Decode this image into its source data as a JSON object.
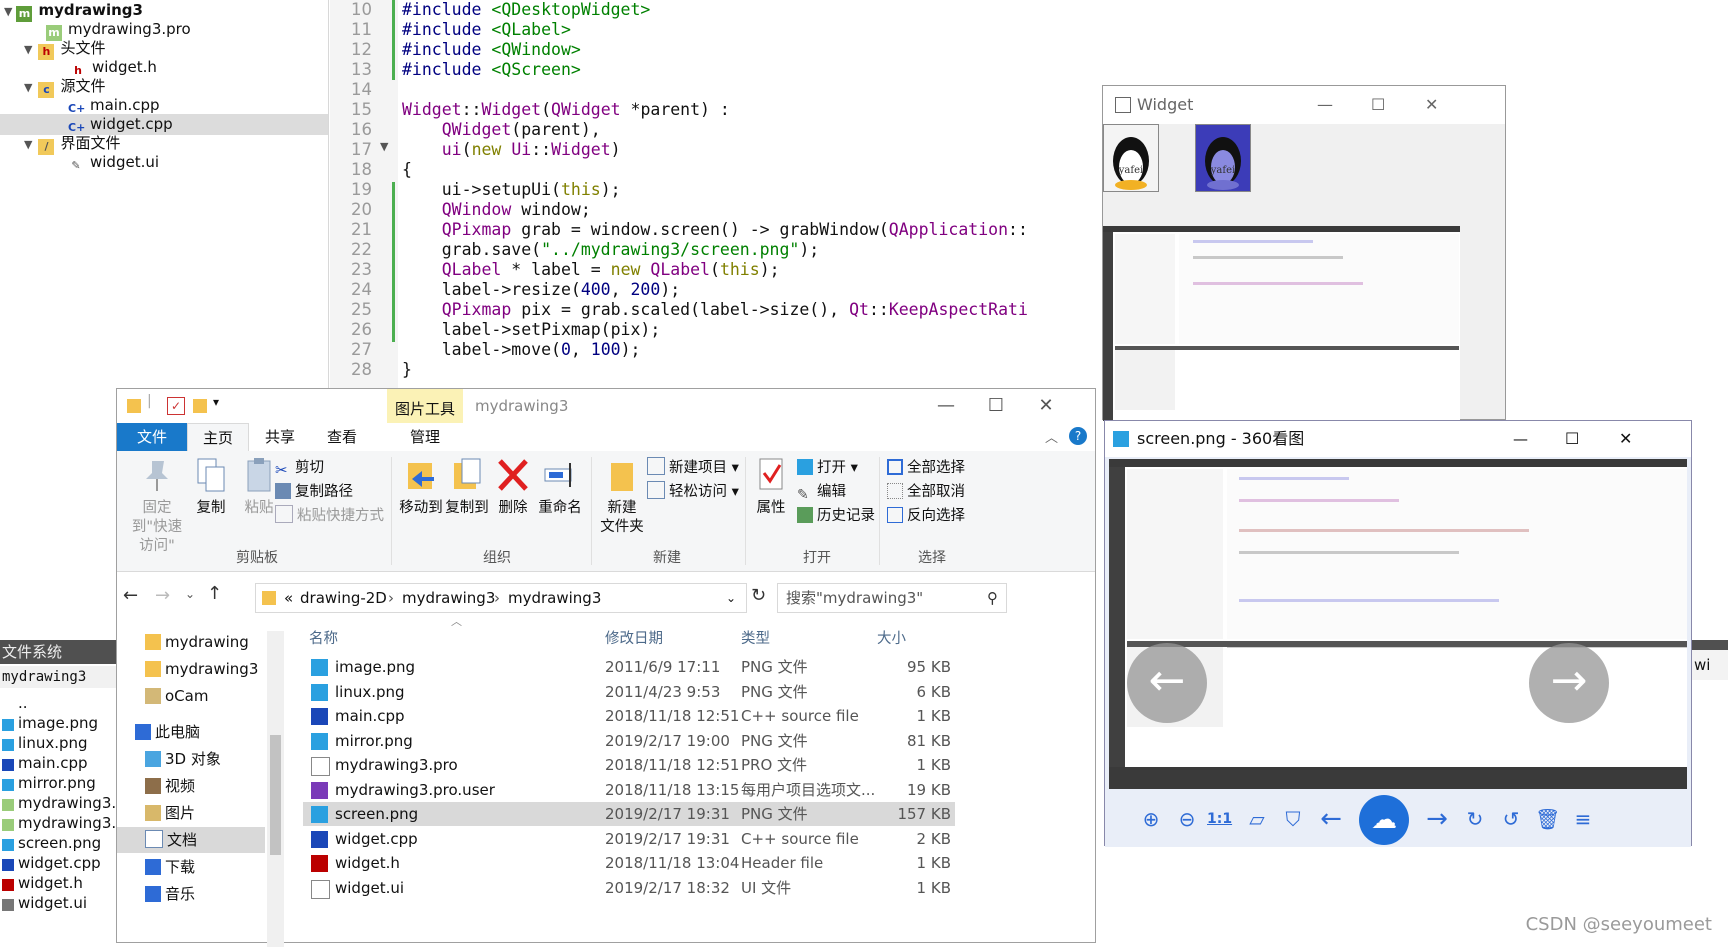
{
  "project_tree": {
    "root": "mydrawing3",
    "items": [
      {
        "label": "mydrawing3.pro",
        "icon": "pro-file-icon"
      },
      {
        "label": "头文件",
        "icon": "folder-icon"
      },
      {
        "label": "widget.h",
        "icon": "header-file-icon"
      },
      {
        "label": "源文件",
        "icon": "folder-icon"
      },
      {
        "label": "main.cpp",
        "icon": "cpp-file-icon"
      },
      {
        "label": "widget.cpp",
        "icon": "cpp-file-icon"
      },
      {
        "label": "界面文件",
        "icon": "folder-icon"
      },
      {
        "label": "widget.ui",
        "icon": "ui-file-icon"
      }
    ]
  },
  "editor": {
    "line_numbers": [
      "10",
      "11",
      "12",
      "13",
      "14",
      "15",
      "16",
      "17",
      "18",
      "19",
      "20",
      "21",
      "22",
      "23",
      "24",
      "25",
      "26",
      "27",
      "28"
    ],
    "lines": [
      "#include <QDesktopWidget>",
      "#include <QLabel>",
      "#include <QWindow>",
      "#include <QScreen>",
      "",
      "Widget::Widget(QWidget *parent) :",
      "    QWidget(parent),",
      "    ui(new Ui::Widget)",
      "{",
      "    ui->setupUi(this);",
      "    QWindow window;",
      "    QPixmap grab = window.screen() -> grabWindow(QApplication::",
      "    grab.save(\"../mydrawing3/screen.png\");",
      "    QLabel * label = new QLabel(this);",
      "    label->resize(400, 200);",
      "    QPixmap pix = grab.scaled(label->size(), Qt::KeepAspectRati",
      "    label->setPixmap(pix);",
      "    label->move(0, 100);",
      "}"
    ]
  },
  "fs_panel": {
    "header": "文件系统",
    "path": "mydrawing3",
    "items": [
      "..",
      "image.png",
      "linux.png",
      "main.cpp",
      "mirror.png",
      "mydrawing3.",
      "mydrawing3.",
      "screen.png",
      "widget.cpp",
      "widget.h",
      "widget.ui"
    ]
  },
  "explorer": {
    "title": "mydrawing3",
    "context_tab": "图片工具",
    "tabs": [
      "文件",
      "主页",
      "共享",
      "查看",
      "管理"
    ],
    "ribbon": {
      "clipboard": {
        "label": "剪贴板",
        "pin": "固定到\"快速访问\"",
        "copy": "复制",
        "paste": "粘贴",
        "cut": "剪切",
        "copy_path": "复制路径",
        "paste_shortcut": "粘贴快捷方式"
      },
      "organize": {
        "label": "组织",
        "move_to": "移动到",
        "copy_to": "复制到",
        "delete": "删除",
        "rename": "重命名"
      },
      "new": {
        "label": "新建",
        "new_folder": "新建\n文件夹",
        "new_item": "新建项目",
        "easy_access": "轻松访问"
      },
      "open": {
        "label": "打开",
        "properties": "属性",
        "open": "打开",
        "edit": "编辑",
        "history": "历史记录"
      },
      "select": {
        "label": "选择",
        "select_all": "全部选择",
        "select_none": "全部取消",
        "invert": "反向选择"
      }
    },
    "address": {
      "prefix": "«",
      "crumbs": [
        "drawing-2D",
        "mydrawing3",
        "mydrawing3"
      ]
    },
    "search_placeholder": "搜索\"mydrawing3\"",
    "nav": [
      "mydrawing",
      "mydrawing3",
      "oCam",
      "此电脑",
      "3D 对象",
      "视频",
      "图片",
      "文档",
      "下载",
      "音乐"
    ],
    "columns": [
      "名称",
      "修改日期",
      "类型",
      "大小"
    ],
    "files": [
      {
        "name": "image.png",
        "date": "2011/6/9 17:11",
        "type": "PNG 文件",
        "size": "95 KB",
        "icon": "png"
      },
      {
        "name": "linux.png",
        "date": "2011/4/23 9:53",
        "type": "PNG 文件",
        "size": "6 KB",
        "icon": "png"
      },
      {
        "name": "main.cpp",
        "date": "2018/11/18 12:51",
        "type": "C++ source file",
        "size": "1 KB",
        "icon": "cpp"
      },
      {
        "name": "mirror.png",
        "date": "2019/2/17 19:00",
        "type": "PNG 文件",
        "size": "81 KB",
        "icon": "png"
      },
      {
        "name": "mydrawing3.pro",
        "date": "2018/11/18 12:51",
        "type": "PRO 文件",
        "size": "1 KB",
        "icon": "blank"
      },
      {
        "name": "mydrawing3.pro.user",
        "date": "2018/11/18 13:15",
        "type": "每用户项目选项文...",
        "size": "19 KB",
        "icon": "user"
      },
      {
        "name": "screen.png",
        "date": "2019/2/17 19:31",
        "type": "PNG 文件",
        "size": "157 KB",
        "icon": "png"
      },
      {
        "name": "widget.cpp",
        "date": "2019/2/17 19:31",
        "type": "C++ source file",
        "size": "2 KB",
        "icon": "cpp"
      },
      {
        "name": "widget.h",
        "date": "2018/11/18 13:04",
        "type": "Header file",
        "size": "1 KB",
        "icon": "h"
      },
      {
        "name": "widget.ui",
        "date": "2019/2/17 18:32",
        "type": "UI 文件",
        "size": "1 KB",
        "icon": "blank"
      }
    ]
  },
  "widget_window": {
    "title": "Widget",
    "penguin_text": "yafei"
  },
  "viewer": {
    "title": "screen.png - 360看图",
    "zoom_label": "1:1"
  },
  "watermark": "CSDN @seeyoumeet",
  "right_strip_text": "wi",
  "colors": {
    "accent": "#1979ca",
    "selected_row": "#d9d9d9",
    "context_tab": "#fbf2b6"
  }
}
